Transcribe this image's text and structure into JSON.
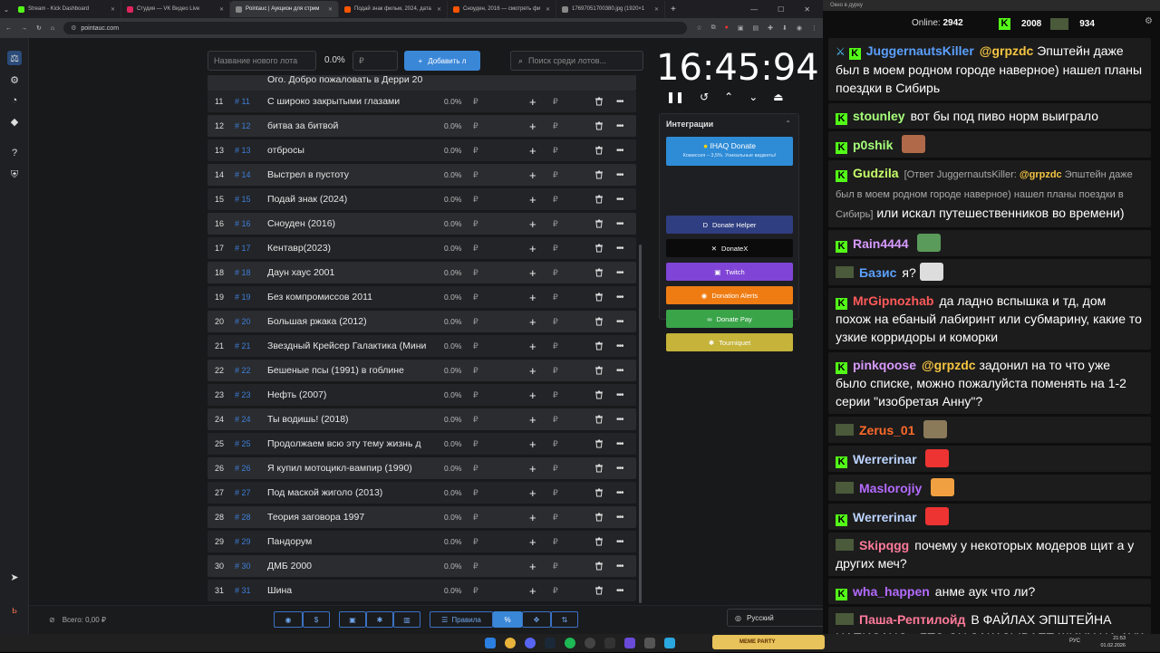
{
  "browser": {
    "tabs": [
      {
        "title": "Stream - Kick Dashboard",
        "color": "#53fc18"
      },
      {
        "title": "Студия — VK Видео Live",
        "color": "#e0245e"
      },
      {
        "title": "Pointauc | Аукцион для стрим",
        "color": "#888888"
      },
      {
        "title": "Подай знак фильм, 2024, дата",
        "color": "#ff5500"
      },
      {
        "title": "Сноуден, 2016 — смотреть фи",
        "color": "#ff5500"
      },
      {
        "title": "17697051700380.jpg (1920×1",
        "color": "#888888"
      }
    ],
    "url": "pointauc.com"
  },
  "auction": {
    "lot_name_placeholder": "Название нового лота",
    "percent_value": "0.0%",
    "amount_placeholder": "₽",
    "add_button_label": "Добавить л",
    "search_placeholder": "Поиск среди лотов...",
    "first_partial_row": "Ого. Добро пожаловать в Дерри 20",
    "lots": [
      {
        "num": "11",
        "id": "# 11",
        "name": "С широко закрытыми глазами",
        "pct": "0.0%"
      },
      {
        "num": "12",
        "id": "# 12",
        "name": "битва за битвой",
        "pct": "0.0%"
      },
      {
        "num": "13",
        "id": "# 13",
        "name": "отбросы",
        "pct": "0.0%"
      },
      {
        "num": "14",
        "id": "# 14",
        "name": "Выстрел в пустоту",
        "pct": "0.0%"
      },
      {
        "num": "15",
        "id": "# 15",
        "name": "Подай знак (2024)",
        "pct": "0.0%"
      },
      {
        "num": "16",
        "id": "# 16",
        "name": "Сноуден (2016)",
        "pct": "0.0%"
      },
      {
        "num": "17",
        "id": "# 17",
        "name": "Кентавр(2023)",
        "pct": "0.0%"
      },
      {
        "num": "18",
        "id": "# 18",
        "name": "Даун хаус 2001",
        "pct": "0.0%"
      },
      {
        "num": "19",
        "id": "# 19",
        "name": "Без компромиссов 2011",
        "pct": "0.0%"
      },
      {
        "num": "20",
        "id": "# 20",
        "name": "Большая ржака (2012)",
        "pct": "0.0%"
      },
      {
        "num": "21",
        "id": "# 21",
        "name": "Звездный Крейсер Галактика (Мини",
        "pct": "0.0%"
      },
      {
        "num": "22",
        "id": "# 22",
        "name": "Бешеные псы (1991) в гоблине",
        "pct": "0.0%"
      },
      {
        "num": "23",
        "id": "# 23",
        "name": "Нефть (2007)",
        "pct": "0.0%"
      },
      {
        "num": "24",
        "id": "# 24",
        "name": "Ты водишь! (2018)",
        "pct": "0.0%"
      },
      {
        "num": "25",
        "id": "# 25",
        "name": "Продолжаем всю эту тему жизнь д",
        "pct": "0.0%"
      },
      {
        "num": "26",
        "id": "# 26",
        "name": "Я купил мотоцикл-вампир (1990)",
        "pct": "0.0%"
      },
      {
        "num": "27",
        "id": "# 27",
        "name": "Под маской жиголо (2013)",
        "pct": "0.0%"
      },
      {
        "num": "28",
        "id": "# 28",
        "name": "Теория заговора 1997",
        "pct": "0.0%"
      },
      {
        "num": "29",
        "id": "# 29",
        "name": "Пандорум",
        "pct": "0.0%"
      },
      {
        "num": "30",
        "id": "# 30",
        "name": "ДМБ 2000",
        "pct": "0.0%"
      },
      {
        "num": "31",
        "id": "# 31",
        "name": "Шина",
        "pct": "0.0%"
      }
    ],
    "currency": "₽",
    "timer": "16:45:94",
    "integrations": {
      "title": "Интеграции",
      "ihaq_title": "IHAQ Donate",
      "ihaq_sub": "Комиссия – 3,5%. Уникальные виджеты!",
      "buttons": [
        {
          "label": "Donate Helper",
          "color": "#2f3e80"
        },
        {
          "label": "DonateX",
          "color": "#0b0b0b"
        },
        {
          "label": "Twitch",
          "color": "#8045d6"
        },
        {
          "label": "Donation Alerts",
          "color": "#ef7c13"
        },
        {
          "label": "Donate Pay",
          "color": "#3aa449"
        },
        {
          "label": "Tourniquet",
          "color": "#c5b33a"
        }
      ]
    },
    "total_label": "Всего: 0,00 ₽",
    "rules_label": "Правила",
    "percent_symbol": "%",
    "language": "Русский"
  },
  "taskbar": {
    "time": "21:53",
    "date": "01.02.2026",
    "lang": "РУС",
    "meme_label": "MEME PARTY"
  },
  "chat": {
    "window_title": "Окно в дурку",
    "online_label": "Online:",
    "online_count": "2942",
    "kick_count": "2008",
    "other_count": "934",
    "messages": [
      {
        "nick": "JuggernautsKiller",
        "nick_color": "#5ba0ff",
        "mention": "@grpzdc",
        "text": "Эпштейн даже был в моем родном городе наверное) нашел планы поездки в Сибирь"
      },
      {
        "nick": "stounley",
        "nick_color": "#a6ff7a",
        "text": "вот бы под пиво норм выиграло"
      },
      {
        "nick": "p0shik",
        "nick_color": "#a6ff7a",
        "text": ""
      },
      {
        "nick": "Gudzila",
        "nick_color": "#c8ff6a",
        "reply": "[Ответ JuggernautsKiller:",
        "reply_mention": "@grpzdc",
        "reply_text": "Эпштейн даже был в моем родном городе наверное) нашел планы поездки в Сибирь]",
        "text": "или искал путешественников во времени)"
      },
      {
        "nick": "Rain4444",
        "nick_color": "#d79aff",
        "text": ""
      },
      {
        "nick": "Базис",
        "nick_color": "#5ba0ff",
        "text": "я?"
      },
      {
        "nick": "MrGipnozhab",
        "nick_color": "#ff5a5a",
        "text": "да ладно вспышка и тд, дом похож на ебаный лабиринт или субмарину, какие то узкие корридоры и коморки"
      },
      {
        "nick": "pinkqoose",
        "nick_color": "#d79aff",
        "mention": "@grpzdc",
        "text": "задонил на то что уже было списке, можно пожалуйста поменять на 1-2 серии \"изобретая Анну\"?"
      },
      {
        "nick": "Zerus_01",
        "nick_color": "#ff6a2a",
        "text": ""
      },
      {
        "nick": "Werrerinar",
        "nick_color": "#bcd4ff",
        "text": ""
      },
      {
        "nick": "Maslorojiy",
        "nick_color": "#b46bff",
        "text": ""
      },
      {
        "nick": "Werrerinar",
        "nick_color": "#bcd4ff",
        "text": ""
      },
      {
        "nick": "Skipqgg",
        "nick_color": "#ff7a9a",
        "text": "почему у некоторых модеров щит а у других меч?"
      },
      {
        "nick": "wha_happen",
        "nick_color": "#b46bff",
        "text": "анме аук что ли?"
      },
      {
        "nick": "Паша-Рептилойд",
        "nick_color": "#ff7a9a",
        "text": "В ФАЙЛАХ ЭПШТЕЙНА НАПИСАНО , ЯТО ОН ЗАКАЗЫВАЕТ ШИНУ НА АУК"
      }
    ]
  }
}
